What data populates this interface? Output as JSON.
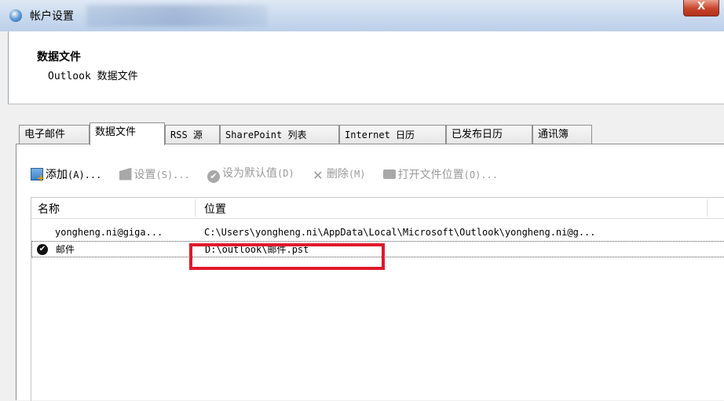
{
  "window": {
    "title": "帐户设置",
    "close_label": "X"
  },
  "header": {
    "title": "数据文件",
    "subtitle": "Outlook 数据文件"
  },
  "tabs": [
    {
      "label": "电子邮件"
    },
    {
      "label": "数据文件"
    },
    {
      "label": "RSS 源"
    },
    {
      "label": "SharePoint 列表"
    },
    {
      "label": "Internet 日历"
    },
    {
      "label": "已发布日历"
    },
    {
      "label": "通讯簿"
    }
  ],
  "toolbar": {
    "add": {
      "label": "添加",
      "key": "(A)..."
    },
    "settings": {
      "label": "设置",
      "key": "(S)..."
    },
    "set_default": {
      "label": "设为默认值",
      "key": "(D)"
    },
    "remove": {
      "label": "删除",
      "key": "(M)"
    },
    "open_location": {
      "label": "打开文件位置",
      "key": "(O)..."
    }
  },
  "list": {
    "columns": {
      "name": "名称",
      "location": "位置"
    },
    "rows": [
      {
        "name": "yongheng.ni@giga...",
        "location": "C:\\Users\\yongheng.ni\\AppData\\Local\\Microsoft\\Outlook\\yongheng.ni@g..."
      },
      {
        "name": "邮件",
        "location": "D:\\outlook\\邮件.pst"
      }
    ]
  },
  "colors": {
    "highlight": "#e0192b",
    "disabled_text": "#9a9a9a"
  }
}
